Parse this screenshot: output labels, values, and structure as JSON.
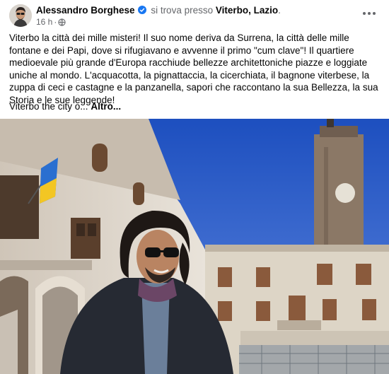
{
  "post": {
    "author": "Alessandro Borghese",
    "connector": "si trova presso",
    "location": "Viterbo, Lazio",
    "location_suffix": ".",
    "time": "16 h",
    "meta_separator": "·",
    "body": "Viterbo la città dei mille misteri!  Il suo nome deriva da Surrena, la città delle mille fontane e dei Papi, dove si rifugiavano e avvenne il primo \"cum clave\"! Il quartiere medioevale più grande d'Europa racchiude bellezze architettoniche piazze e loggiate uniche al mondo. L'acquacotta, la pignattaccia, la cicerchiata, il bagnone viterbese, la zuppa di ceci e castagne e la panzanella, sapori che raccontano la sua Bellezza, la sua Storia e le sue leggende!",
    "snippet": "Viterbo the city o...",
    "more_label": "Altro..."
  },
  "icons": {
    "verified": "verified-badge-icon",
    "privacy": "globe-icon",
    "menu": "more-options-icon"
  },
  "colors": {
    "verified_blue": "#1877f2",
    "secondary_text": "#65676b",
    "primary_text": "#050505",
    "sky": "#2f5fc9"
  }
}
